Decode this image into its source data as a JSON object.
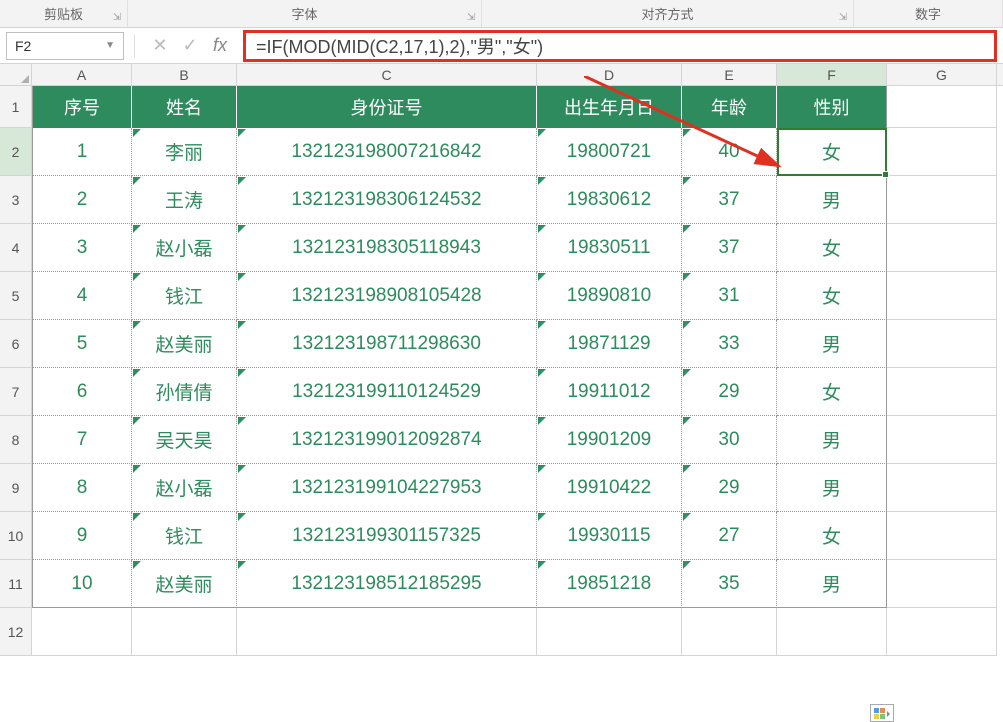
{
  "ribbon": {
    "groups": [
      "剪贴板",
      "字体",
      "对齐方式",
      "数字"
    ]
  },
  "formula_bar": {
    "name_box": "F2",
    "cancel_glyph": "✕",
    "confirm_glyph": "✓",
    "fx_label": "fx",
    "formula": "=IF(MOD(MID(C2,17,1),2),\"男\",\"女\")"
  },
  "columns": [
    "A",
    "B",
    "C",
    "D",
    "E",
    "F",
    "G"
  ],
  "selected_cell": {
    "col": "F",
    "row": 2
  },
  "table": {
    "headers": [
      "序号",
      "姓名",
      "身份证号",
      "出生年月日",
      "年龄",
      "性别"
    ],
    "rows": [
      [
        "1",
        "李丽",
        "132123198007216842",
        "19800721",
        "40",
        "女"
      ],
      [
        "2",
        "王涛",
        "132123198306124532",
        "19830612",
        "37",
        "男"
      ],
      [
        "3",
        "赵小磊",
        "132123198305118943",
        "19830511",
        "37",
        "女"
      ],
      [
        "4",
        "钱江",
        "132123198908105428",
        "19890810",
        "31",
        "女"
      ],
      [
        "5",
        "赵美丽",
        "132123198711298630",
        "19871129",
        "33",
        "男"
      ],
      [
        "6",
        "孙倩倩",
        "132123199110124529",
        "19911012",
        "29",
        "女"
      ],
      [
        "7",
        "吴天昊",
        "132123199012092874",
        "19901209",
        "30",
        "男"
      ],
      [
        "8",
        "赵小磊",
        "132123199104227953",
        "19910422",
        "29",
        "男"
      ],
      [
        "9",
        "钱江",
        "132123199301157325",
        "19930115",
        "27",
        "女"
      ],
      [
        "10",
        "赵美丽",
        "132123198512185295",
        "19851218",
        "35",
        "男"
      ]
    ]
  },
  "row_numbers": [
    1,
    2,
    3,
    4,
    5,
    6,
    7,
    8,
    9,
    10,
    11,
    12
  ]
}
